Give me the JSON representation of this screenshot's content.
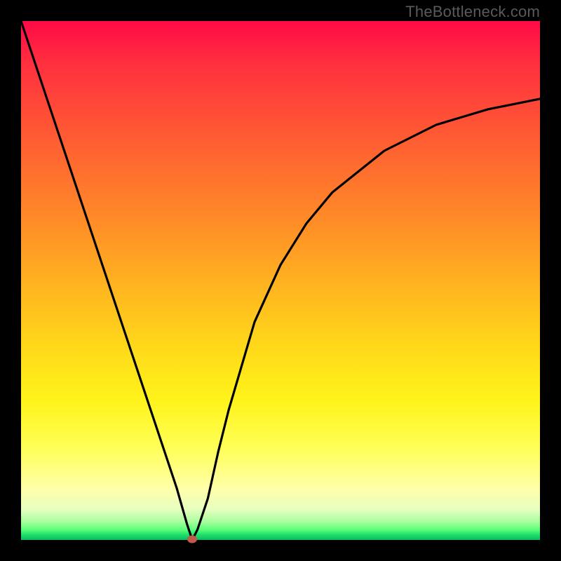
{
  "watermark": "TheBottleneck.com",
  "chart_data": {
    "type": "line",
    "title": "",
    "xlabel": "",
    "ylabel": "",
    "xlim": [
      0,
      100
    ],
    "ylim": [
      0,
      100
    ],
    "grid": false,
    "legend": false,
    "background_gradient": {
      "top": "#ff0a46",
      "bottom": "#0db85a",
      "stops": [
        "red",
        "orange",
        "yellow",
        "light-yellow",
        "green"
      ]
    },
    "series": [
      {
        "name": "bottleneck-curve",
        "color": "#000000",
        "x": [
          0,
          5,
          10,
          15,
          20,
          25,
          30,
          32,
          33,
          34,
          36,
          38,
          40,
          45,
          50,
          55,
          60,
          65,
          70,
          75,
          80,
          85,
          90,
          95,
          100
        ],
        "values": [
          100,
          85,
          70,
          55,
          40,
          25,
          10,
          3,
          0,
          2,
          8,
          17,
          25,
          42,
          53,
          61,
          67,
          71,
          75,
          77.5,
          80,
          81.5,
          83,
          84,
          85
        ]
      }
    ],
    "marker": {
      "label": "optimal-point",
      "x": 33,
      "y": 0,
      "color": "#c05a4a"
    }
  }
}
